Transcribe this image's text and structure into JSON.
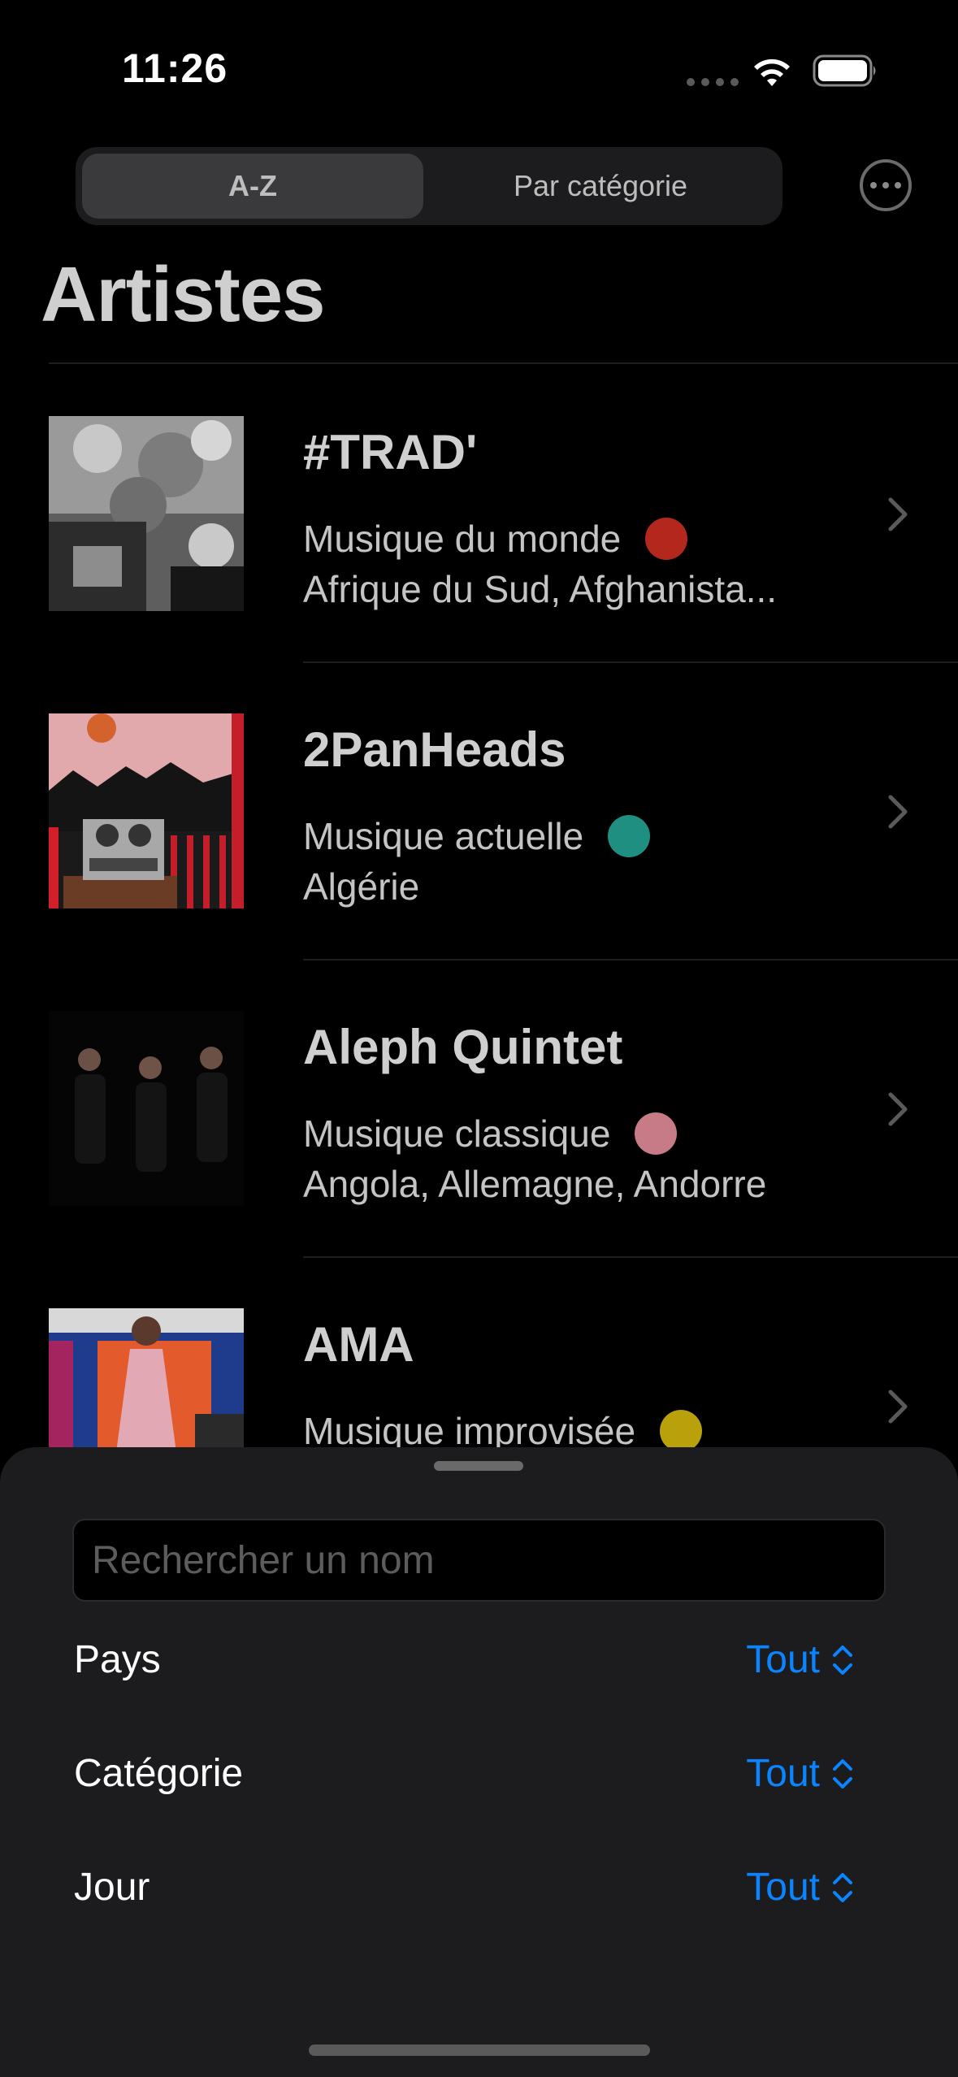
{
  "status_bar": {
    "time": "11:26"
  },
  "segmented": {
    "az_label": "A-Z",
    "category_label": "Par catégorie",
    "selected": "A-Z"
  },
  "page": {
    "title": "Artistes"
  },
  "artists": [
    {
      "name": "#TRAD'",
      "category": "Musique du monde",
      "category_color": "#b3271d",
      "countries": "Afrique du Sud, Afghanista..."
    },
    {
      "name": "2PanHeads",
      "category": "Musique actuelle",
      "category_color": "#1f8f82",
      "countries": "Algérie"
    },
    {
      "name": "Aleph Quintet",
      "category": "Musique classique",
      "category_color": "#c67b86",
      "countries": "Angola, Allemagne, Andorre"
    },
    {
      "name": "AMA",
      "category": "Musique improvisée",
      "category_color": "#b8a10b",
      "countries": ""
    }
  ],
  "filters": {
    "search_placeholder": "Rechercher un nom",
    "search_value": "",
    "rows": [
      {
        "label": "Pays",
        "value": "Tout"
      },
      {
        "label": "Catégorie",
        "value": "Tout"
      },
      {
        "label": "Jour",
        "value": "Tout"
      }
    ]
  }
}
